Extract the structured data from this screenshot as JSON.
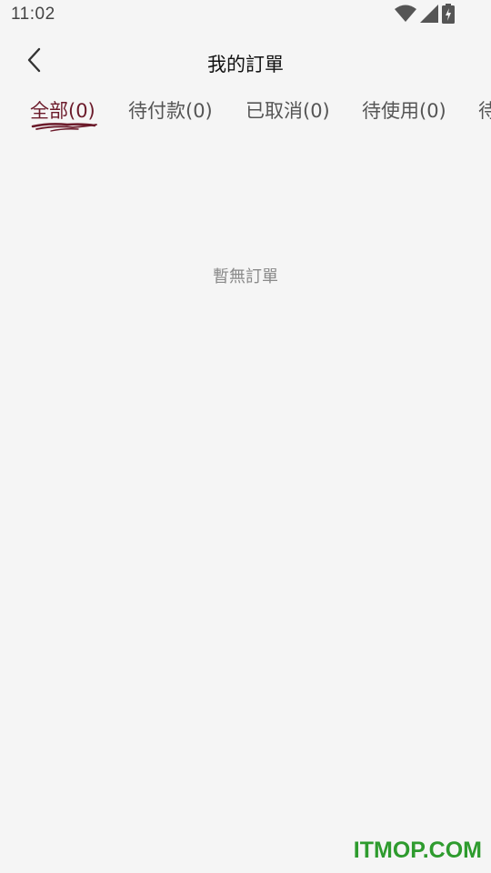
{
  "status_bar": {
    "time": "11:02",
    "icons": [
      "wifi-icon",
      "cell-signal-icon",
      "battery-charging-icon"
    ]
  },
  "header": {
    "back_icon": "chevron-left-icon",
    "title": "我的訂單"
  },
  "tabs": [
    {
      "label": "全部(0)",
      "active": true
    },
    {
      "label": "待付款(0)",
      "active": false
    },
    {
      "label": "已取消(0)",
      "active": false
    },
    {
      "label": "待使用(0)",
      "active": false
    },
    {
      "label": "待",
      "active": false
    }
  ],
  "empty_state": {
    "message": "暫無訂單"
  },
  "watermark": {
    "text": "ITMOP.COM"
  },
  "colors": {
    "background": "#f5f5f5",
    "accent": "#6b1a2a",
    "watermark": "#2e9b2e"
  }
}
